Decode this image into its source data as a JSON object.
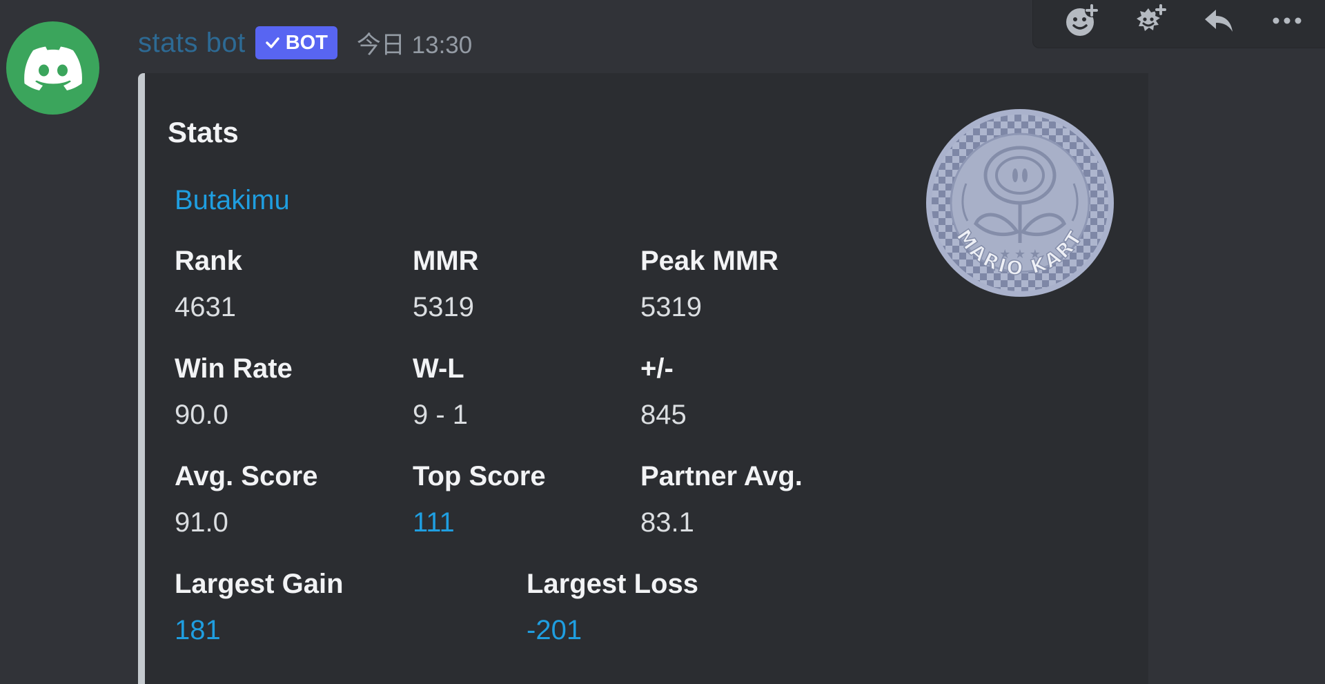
{
  "message": {
    "author": "stats bot",
    "bot_tag": "BOT",
    "timestamp": "今日 13:30"
  },
  "toolbar": {
    "icons": [
      "add-reaction-icon",
      "super-reaction-icon",
      "reply-icon",
      "more-icon"
    ]
  },
  "embed": {
    "title": "Stats",
    "description": "Butakimu",
    "thumbnail_label": "MARIO KART",
    "fields": {
      "rank": {
        "name": "Rank",
        "value": "4631"
      },
      "mmr": {
        "name": "MMR",
        "value": "5319"
      },
      "peak_mmr": {
        "name": "Peak MMR",
        "value": "5319"
      },
      "win_rate": {
        "name": "Win Rate",
        "value": "90.0"
      },
      "wl": {
        "name": "W-L",
        "value": "9 - 1"
      },
      "plus_minus": {
        "name": "+/-",
        "value": "845"
      },
      "avg_score": {
        "name": "Avg. Score",
        "value": "91.0"
      },
      "top_score": {
        "name": "Top Score",
        "value": "111"
      },
      "partner_avg": {
        "name": "Partner Avg.",
        "value": "83.1"
      },
      "largest_gain": {
        "name": "Largest Gain",
        "value": "181"
      },
      "largest_loss": {
        "name": "Largest Loss",
        "value": "-201"
      }
    }
  },
  "colors": {
    "background": "#313338",
    "embed_background": "#2b2d31",
    "embed_border": "#c4c9ce",
    "link": "#1f9ee0",
    "username": "#2d6a94",
    "bot_tag": "#5865f2",
    "avatar": "#3ba55c"
  }
}
